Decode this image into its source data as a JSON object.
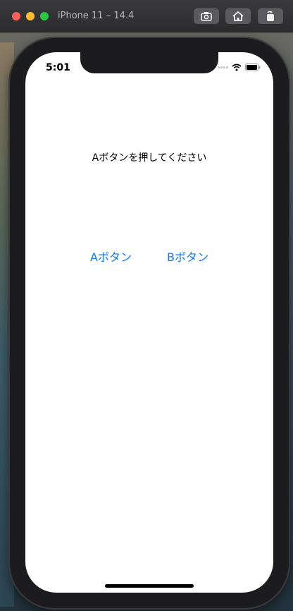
{
  "window": {
    "title": "iPhone 11 – 14.4"
  },
  "toolbar": {
    "icons": [
      "camera-icon",
      "home-icon",
      "rotate-icon"
    ]
  },
  "status_bar": {
    "time": "5:01"
  },
  "content": {
    "prompt": "Aボタンを押してください",
    "button_a_label": "Aボタン",
    "button_b_label": "Bボタン"
  },
  "colors": {
    "accent": "#0a7aff",
    "close": "#ff5f57",
    "minimize": "#febc2e",
    "zoom": "#28c840"
  }
}
